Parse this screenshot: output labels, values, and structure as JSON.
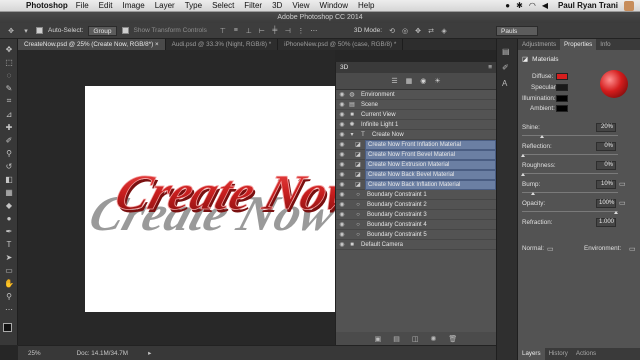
{
  "menubar": {
    "app": "Photoshop",
    "items": [
      "File",
      "Edit",
      "Image",
      "Layer",
      "Type",
      "Select",
      "Filter",
      "3D",
      "View",
      "Window",
      "Help"
    ],
    "user": "Paul Ryan Trani"
  },
  "window": {
    "title": "Adobe Photoshop CC 2014"
  },
  "options": {
    "auto_select_label": "Auto-Select:",
    "auto_select_value": "Group",
    "show_transform_label": "Show Transform Controls",
    "mode_label": "3D Mode:",
    "workspace": "Pauls"
  },
  "doc_tabs": [
    {
      "label": "CreateNow.psd @ 25% (Create Now, RGB/8*) ×",
      "active": true
    },
    {
      "label": "Audi.psd @ 33.3% (Night, RGB/8) *",
      "active": false
    },
    {
      "label": "iPhoneNew.psd @ 50% (case, RGB/8) *",
      "active": false
    }
  ],
  "canvas": {
    "text": "Create Now",
    "text_color": "#c81e1e",
    "shadow_color": "#9a9a9a"
  },
  "status": {
    "zoom": "25%",
    "doc": "Doc: 14.1M/34.7M"
  },
  "panel3d": {
    "title": "3D",
    "rows": [
      {
        "label": "Environment",
        "indent": 0,
        "icon": "environment-icon",
        "selected": false
      },
      {
        "label": "Scene",
        "indent": 0,
        "icon": "scene-icon",
        "selected": false
      },
      {
        "label": "Current View",
        "indent": 1,
        "icon": "camera-icon",
        "selected": false
      },
      {
        "label": "Infinite Light 1",
        "indent": 1,
        "icon": "light-icon",
        "selected": false
      },
      {
        "label": "Create Now",
        "indent": 1,
        "icon": "mesh-icon",
        "selected": false
      },
      {
        "label": "Create Now Front Inflation Material",
        "indent": 2,
        "icon": "material-icon",
        "selected": true
      },
      {
        "label": "Create Now Front Bevel Material",
        "indent": 2,
        "icon": "material-icon",
        "selected": true
      },
      {
        "label": "Create Now Extrusion Material",
        "indent": 2,
        "icon": "material-icon",
        "selected": true
      },
      {
        "label": "Create Now Back Bevel Material",
        "indent": 2,
        "icon": "material-icon",
        "selected": true
      },
      {
        "label": "Create Now Back Inflation Material",
        "indent": 2,
        "icon": "material-icon",
        "selected": true
      },
      {
        "label": "Boundary Constraint 1",
        "indent": 2,
        "icon": "constraint-icon",
        "selected": false
      },
      {
        "label": "Boundary Constraint 2",
        "indent": 2,
        "icon": "constraint-icon",
        "selected": false
      },
      {
        "label": "Boundary Constraint 3",
        "indent": 2,
        "icon": "constraint-icon",
        "selected": false
      },
      {
        "label": "Boundary Constraint 4",
        "indent": 2,
        "icon": "constraint-icon",
        "selected": false
      },
      {
        "label": "Boundary Constraint 5",
        "indent": 2,
        "icon": "constraint-icon",
        "selected": false
      },
      {
        "label": "Default Camera",
        "indent": 1,
        "icon": "camera-icon",
        "selected": false
      }
    ]
  },
  "properties": {
    "tabs": [
      "Adjustments",
      "Properties",
      "Info"
    ],
    "header": "Materials",
    "diffuse_label": "Diffuse:",
    "specular_label": "Specular:",
    "illumination_label": "Illumination:",
    "ambient_label": "Ambient:",
    "diffuse_color": "#d61e1e",
    "specular_color": "#1a1a1a",
    "illumination_color": "#000000",
    "ambient_color": "#000000",
    "shine_label": "Shine:",
    "shine_value": "20%",
    "reflection_label": "Reflection:",
    "reflection_value": "0%",
    "roughness_label": "Roughness:",
    "roughness_value": "0%",
    "bump_label": "Bump:",
    "bump_value": "10%",
    "opacity_label": "Opacity:",
    "opacity_value": "100%",
    "refraction_label": "Refraction:",
    "refraction_value": "1.000",
    "normal_label": "Normal:",
    "environment_label": "Environment:",
    "bottom_tabs": [
      "Layers",
      "History",
      "Actions"
    ]
  }
}
